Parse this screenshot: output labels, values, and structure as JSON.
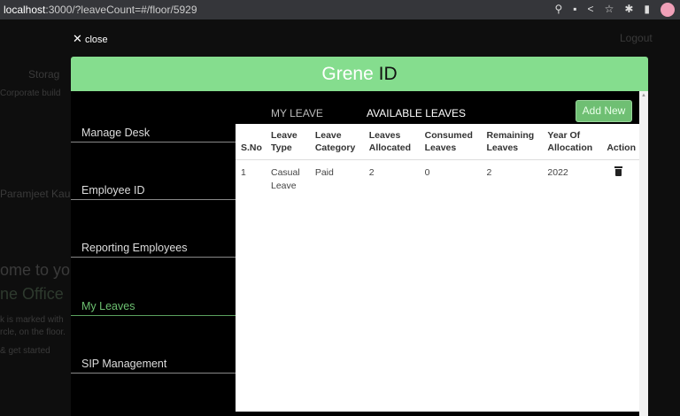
{
  "browser": {
    "host": "localhost",
    "path": ":3000/?leaveCount=#/floor/5929"
  },
  "background": {
    "storage": "Storag",
    "logout": "Logout",
    "corporate": "Corporate build",
    "user": "Paramjeet Kaur",
    "welcome": "ome to you",
    "office": "ne Office",
    "desk_note": "k is marked with",
    "desk_note2": "rcle, on the floor.",
    "get_started": "& get started"
  },
  "modal": {
    "close_label": "close",
    "title_main": "Grene",
    "title_id": "ID"
  },
  "sidebar": {
    "items": [
      {
        "label": "Manage Desk"
      },
      {
        "label": "Employee ID"
      },
      {
        "label": "Reporting Employees"
      },
      {
        "label": "My Leaves",
        "active": true
      },
      {
        "label": "SIP Management"
      }
    ]
  },
  "tabs": [
    {
      "label": "MY LEAVE"
    },
    {
      "label": "AVAILABLE LEAVES",
      "active": true
    }
  ],
  "add_new_label": "Add New",
  "accent": "#85dd8e",
  "table": {
    "headers": [
      "S.No",
      "Leave Type",
      "Leave Category",
      "Leaves Allocated",
      "Consumed Leaves",
      "Remaining Leaves",
      "Year Of Allocation",
      "Action"
    ],
    "rows": [
      {
        "sno": "1",
        "type": "Casual Leave",
        "category": "Paid",
        "allocated": "2",
        "consumed": "0",
        "remaining": "2",
        "year": "2022",
        "action": "trash-icon"
      }
    ]
  }
}
